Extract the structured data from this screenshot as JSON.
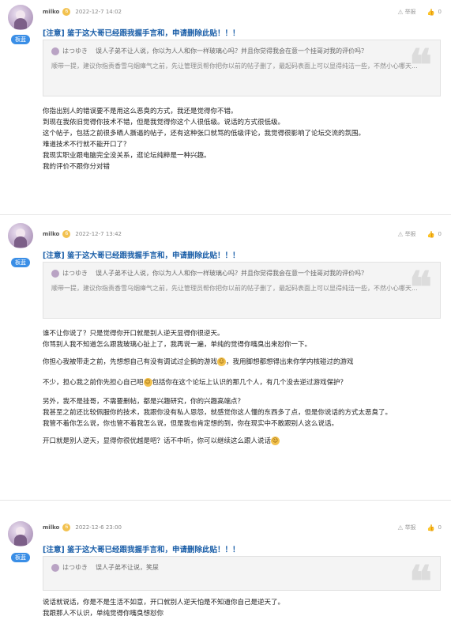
{
  "actions": {
    "report_label": "举报",
    "like_count": "0"
  },
  "posts": [
    {
      "username": "milko",
      "level": "6",
      "badge": "板蓝",
      "timestamp": "2022-12-7 14:02",
      "title": "[注意] 鉴于这大哥已经跟我握手言和，申请删除此贴！！！",
      "quote_user": "はつゆき",
      "quote_first": "误人子弟不让人说，你以为人人和你一样玻璃心吗？并且你觉得我会在意一个挂哥对我的评价吗？",
      "quote_rest": "顺带一提，建议你指责香雪乌烟瘴气之前，先让管理员帮你把你以前的帖子删了，最起码表面上可以显得纯洁一些，不然小心哪天...",
      "paragraphs": [
        "你指出别人的错误要不是用这么恶臭的方式，我还是觉得你不错。",
        "到现在我依旧觉得你技术不错，但是我觉得你这个人很低级。说话的方式很低级。",
        "这个帖子，包括之前很多晒人撕逼的帖子，还有这种张口就骂的低级评论，我觉得很影响了论坛交流的氛围。",
        "难道技术不行就不能开口了？",
        "我现实职业跟电脑完全没关系，逛论坛纯粹是一种兴趣。",
        "我的评价不跟你分对错"
      ]
    },
    {
      "username": "milko",
      "level": "6",
      "badge": "板蓝",
      "timestamp": "2022-12-7 13:42",
      "title": "[注意] 鉴于这大哥已经跟我握手言和，申请删除此贴！！！",
      "quote_user": "はつゆき",
      "quote_first": "误人子弟不让人说，你以为人人和你一样玻璃心吗？并且你觉得我会在意一个挂哥对我的评价吗？",
      "quote_rest": "顺带一提，建议你指责香雪乌烟瘴气之前，先让管理员帮你把你以前的帖子删了，最起码表面上可以显得纯洁一些，不然小心哪天...",
      "paragraphs": [
        "谁不让你说了？只是觉得你开口就是别人逆天显得你很逆天。",
        "你骂别人我不知道怎么跟我玻璃心扯上了，我再说一遍，单纯的觉得你嘴臭出来怼你一下。",
        "你担心我被带走之前，先想想自己有没有调试过企鹅的游戏",
        "，我用脚想都想得出来你学内核碰过的游戏",
        "不少，担心我之前你先担心自己吧",
        "包括你在这个论坛上认识的那几个人，有几个没去逆过游戏保护？",
        "另外，我不是挂哥，不需要删帖，都是兴趣研究，你的兴趣高端点？",
        "我甚至之前还比较佩服你的技术，我跟你没有私人恩怨，就感觉你这人懂的东西多了点，但是你说话的方式太恶臭了。",
        "我管不着你怎么说，你也管不着我怎么说，但是我也肯定想的到，你在现实中不敢跟别人这么说话。",
        "开口就是别人逆天，显得你很优越是吧？话不中听，你可以继续这么跟人说话"
      ]
    },
    {
      "username": "milko",
      "level": "6",
      "badge": "板蓝",
      "timestamp": "2022-12-6 23:00",
      "title": "[注意] 鉴于这大哥已经跟我握手言和，申请删除此贴！！！",
      "quote_user": "はつゆき",
      "quote_first": "误人子弟不让说，笑尿",
      "paragraphs": [
        "说话就说话，你是不是生活不如意，开口就别人逆天怕是不知道你自己是逆天了。",
        "我跟那人不认识，单纯觉得你嘴臭想怼你"
      ]
    }
  ]
}
